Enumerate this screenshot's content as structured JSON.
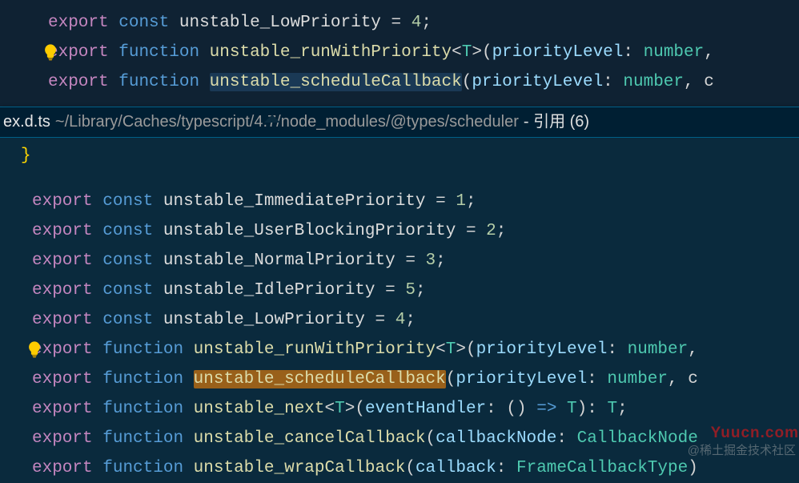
{
  "top": {
    "lines": {
      "l1": {
        "kw1": "export",
        "kw2": "const",
        "name": "unstable_LowPriority",
        "op": "=",
        "val": "4",
        "semi": ";"
      },
      "l2": {
        "kw1": "export",
        "kw2": "function",
        "name": "unstable_runWithPriority",
        "lt": "<",
        "tp": "T",
        "gt": ">",
        "open": "(",
        "p1": "priorityLevel",
        "colon": ":",
        "t1": "number",
        "comma": ","
      },
      "l3": {
        "kw1": "export",
        "kw2": "function",
        "name": "unstable_scheduleCallback",
        "open": "(",
        "p1": "priorityLevel",
        "colon": ":",
        "t1": "number",
        "comma": ", c"
      }
    }
  },
  "peek": {
    "title": "ex.d.ts",
    "path": "~/Library/Caches/typescript/4.7/node_modules/@types/scheduler",
    "ref": " - 引用 (6)"
  },
  "bottom": {
    "closingBrace": "}",
    "lines": {
      "b1": {
        "kw1": "export",
        "kw2": "const",
        "name": "unstable_ImmediatePriority",
        "op": "=",
        "val": "1",
        "semi": ";"
      },
      "b2": {
        "kw1": "export",
        "kw2": "const",
        "name": "unstable_UserBlockingPriority",
        "op": "=",
        "val": "2",
        "semi": ";"
      },
      "b3": {
        "kw1": "export",
        "kw2": "const",
        "name": "unstable_NormalPriority",
        "op": "=",
        "val": "3",
        "semi": ";"
      },
      "b4": {
        "kw1": "export",
        "kw2": "const",
        "name": "unstable_IdlePriority",
        "op": "=",
        "val": "5",
        "semi": ";"
      },
      "b5": {
        "kw1": "export",
        "kw2": "const",
        "name": "unstable_LowPriority",
        "op": "=",
        "val": "4",
        "semi": ";"
      },
      "b6": {
        "kw1": "export",
        "kw2": "function",
        "name": "unstable_runWithPriority",
        "lt": "<",
        "tp": "T",
        "gt": ">",
        "open": "(",
        "p1": "priorityLevel",
        "colon": ":",
        "t1": "number",
        "comma": ","
      },
      "b7": {
        "kw1": "export",
        "kw2": "function",
        "name": "unstable_scheduleCallback",
        "open": "(",
        "p1": "priorityLevel",
        "colon": ":",
        "t1": "number",
        "comma": ", c"
      },
      "b8": {
        "kw1": "export",
        "kw2": "function",
        "name": "unstable_next",
        "lt": "<",
        "tp": "T",
        "gt": ">",
        "open": "(",
        "p1": "eventHandler",
        "colon": ":",
        "open2": "(",
        "close2": ")",
        "arrow": "=>",
        "rt": "T",
        "close": ")",
        "colon2": ":",
        "rt2": "T",
        "semi": ";"
      },
      "b9": {
        "kw1": "export",
        "kw2": "function",
        "name": "unstable_cancelCallback",
        "open": "(",
        "p1": "callbackNode",
        "colon": ":",
        "t1": "CallbackNode"
      },
      "b10": {
        "kw1": "export",
        "kw2": "function",
        "name": "unstable_wrapCallback",
        "open": "(",
        "p1": "callback",
        "colon": ":",
        "t1": "FrameCallbackType",
        "close": ")"
      }
    }
  },
  "watermark1": "Yuucn.com",
  "watermark2": "@稀土掘金技术社区"
}
